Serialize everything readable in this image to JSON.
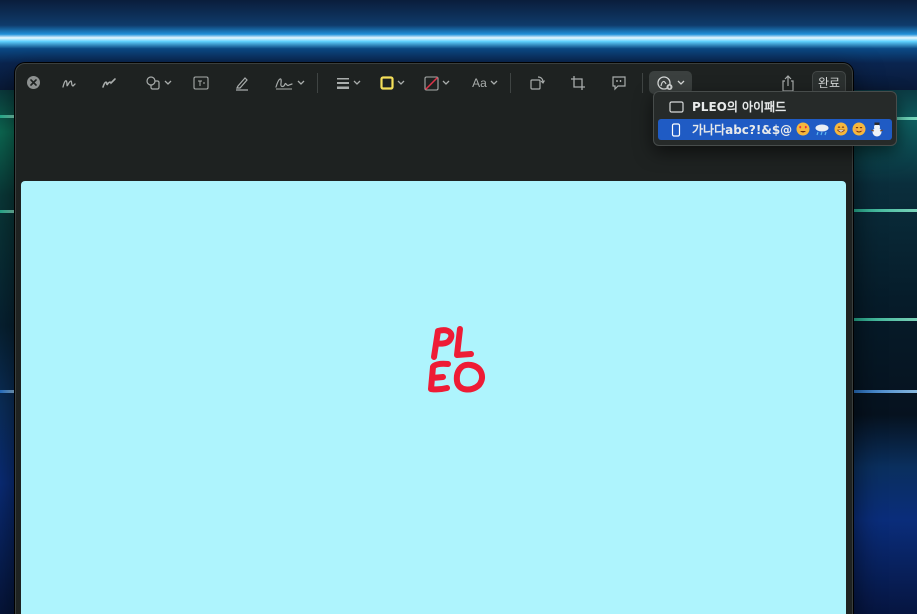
{
  "toolbar": {
    "text_style_label": "Aa",
    "done_label": "완료",
    "icons": [
      "close-icon",
      "sketch-icon",
      "draw-icon",
      "shapes-icon",
      "textbox-icon",
      "highlight-icon",
      "signature-icon",
      "line-weight-icon",
      "border-color-icon",
      "fill-color-icon",
      "text-style-icon",
      "rotate-icon",
      "crop-icon",
      "annotate-icon",
      "markup-device-icon",
      "share-icon"
    ]
  },
  "menu": {
    "items": [
      {
        "label": "PLEO의 아이패드",
        "icon": "ipad-icon"
      },
      {
        "label": "가나다abc?!&$@",
        "icon": "iphone-icon",
        "selected": true,
        "emojis": [
          "heart-eyes-emoji",
          "cloud-rain-emoji",
          "grin-emoji",
          "smile-emoji",
          "snowman-emoji"
        ]
      }
    ]
  },
  "document": {
    "background": "#aef4fd",
    "logo_text_line1": "PL",
    "logo_text_line2": "EO",
    "logo_color": "#ee1c35"
  },
  "colors": {
    "toolbar_bg": "#1e2221",
    "menu_selected": "#1f5bc4",
    "border_swatch": "#f5e05a"
  }
}
